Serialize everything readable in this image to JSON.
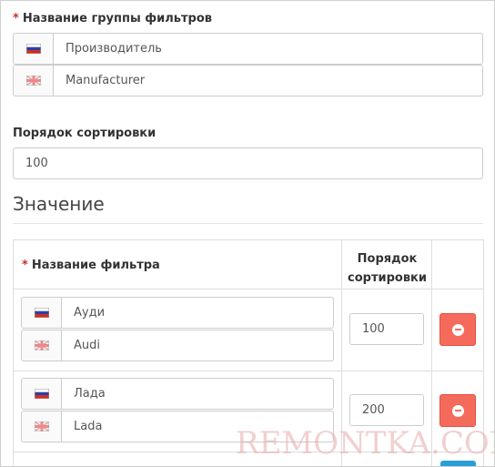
{
  "filter_group": {
    "label": "Название группы фильтров",
    "required_mark": "*",
    "values": [
      {
        "lang": "ru",
        "flag_icon": "flag-ru-icon",
        "value": "Производитель"
      },
      {
        "lang": "en",
        "flag_icon": "flag-uk-icon",
        "value": "Manufacturer"
      }
    ]
  },
  "sort_order": {
    "label": "Порядок сортировки",
    "value": "100"
  },
  "values_section": {
    "title": "Значение",
    "columns": {
      "name": "Название фильтра",
      "name_required_mark": "*",
      "sort_line1": "Порядок",
      "sort_line2": "сортировки"
    },
    "rows": [
      {
        "names": [
          {
            "lang": "ru",
            "value": "Ауди"
          },
          {
            "lang": "en",
            "value": "Audi"
          }
        ],
        "sort_order": "100",
        "delete_icon": "minus-circle-icon"
      },
      {
        "names": [
          {
            "lang": "ru",
            "value": "Лада"
          },
          {
            "lang": "en",
            "value": "Lada"
          }
        ],
        "sort_order": "200",
        "delete_icon": "minus-circle-icon"
      }
    ]
  },
  "watermark": "REMONTKA.COM",
  "colors": {
    "required": "#c9302c",
    "delete_button": "#f56b5b",
    "add_button": "#2a9fd6"
  }
}
